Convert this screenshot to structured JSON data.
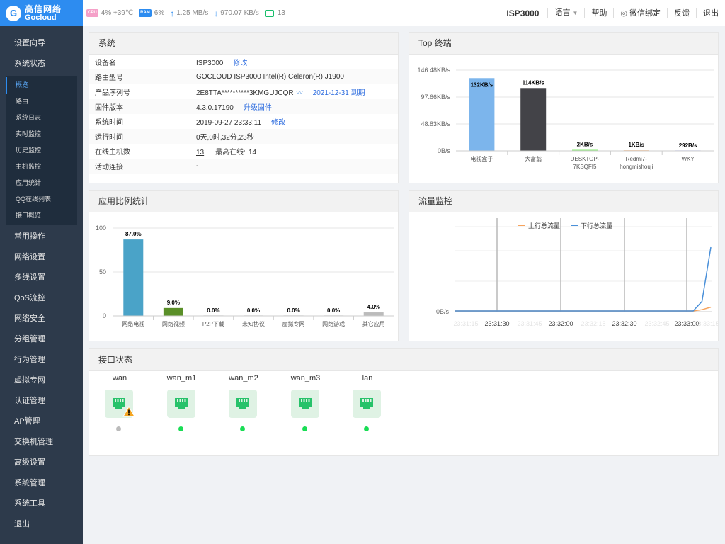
{
  "brand": {
    "name_cn": "高信网络",
    "name_en": "Gocloud",
    "mark": "G",
    "color": "#2d8cf0"
  },
  "topbar": {
    "cpu_tag": "CPU",
    "cpu": "4% +39℃",
    "ram_tag": "RAM",
    "ram": "6%",
    "upload": "1.25 MB/s",
    "download": "970.07 KB/s",
    "monitor": "13",
    "device": "ISP3000",
    "language": "语言",
    "help": "帮助",
    "wechat": "微信绑定",
    "feedback": "反馈",
    "logout": "退出"
  },
  "sidebar": {
    "items_top": [
      "设置向导",
      "系统状态"
    ],
    "sub_items": [
      "概览",
      "路由",
      "系统日志",
      "实时监控",
      "历史监控",
      "主机监控",
      "应用统计",
      "QQ在线列表",
      "接口概览"
    ],
    "active_sub": "概览",
    "items_bottom": [
      "常用操作",
      "网络设置",
      "多线设置",
      "QoS流控",
      "网络安全",
      "分组管理",
      "行为管理",
      "虚拟专网",
      "认证管理",
      "AP管理",
      "交换机管理",
      "高级设置",
      "系统管理",
      "系统工具",
      "退出"
    ]
  },
  "system": {
    "title": "系统",
    "rows": [
      {
        "key": "设备名",
        "value": "ISP3000",
        "link": "修改"
      },
      {
        "key": "路由型号",
        "value": "GOCLOUD ISP3000 Intel(R) Celeron(R) J1900"
      },
      {
        "key": "产品序列号",
        "value": "2E8TTA**********3KMGUJCQR",
        "link": "2021-12-31 到期"
      },
      {
        "key": "固件版本",
        "value": "4.3.0.17190",
        "link": "升级固件"
      },
      {
        "key": "系统时间",
        "value": "2019-09-27 23:33:11",
        "link": "修改"
      },
      {
        "key": "运行时间",
        "value": "0天,0时,32分,23秒"
      },
      {
        "key": "在线主机数",
        "value": "13",
        "extra_label": "最高在线:",
        "extra_value": "14"
      },
      {
        "key": "活动连接",
        "value": "-"
      }
    ]
  },
  "top_terminal": {
    "title": "Top 终端",
    "chart_data": {
      "type": "bar",
      "categories": [
        "电视盒子",
        "大富翁",
        "DESKTOP-7KSQFI5",
        "Redmi7-hongmishouji",
        "WKY"
      ],
      "category_lines": [
        [
          "电视盒子"
        ],
        [
          "大富翁"
        ],
        [
          "DESKTOP-",
          "7KSQFI5"
        ],
        [
          "Redmi7-",
          "hongmishouji"
        ],
        [
          "WKY"
        ]
      ],
      "values": [
        132,
        114,
        2,
        1,
        0.285
      ],
      "labels": [
        "132KB/s",
        "114KB/s",
        "2KB/s",
        "1KB/s",
        "292B/s"
      ],
      "colors": [
        "#7cb5ec",
        "#434348",
        "#90ed7d",
        "#f7a35c",
        "#8085e9"
      ],
      "yticks": [
        0,
        48.83,
        97.66,
        146.48
      ],
      "ytick_labels": [
        "0B/s",
        "48.83KB/s",
        "97.66KB/s",
        "146.48KB/s"
      ],
      "ylim": [
        0,
        146.48
      ]
    }
  },
  "app_ratio": {
    "title": "应用比例统计",
    "chart_data": {
      "type": "bar",
      "categories": [
        "网络电视",
        "网络视频",
        "P2P下载",
        "未知协议",
        "虚拟专网",
        "网络游戏",
        "其它应用"
      ],
      "values": [
        87.0,
        9.0,
        0.0,
        0.0,
        0.0,
        0.0,
        4.0
      ],
      "labels": [
        "87.0%",
        "9.0%",
        "0.0%",
        "0.0%",
        "0.0%",
        "0.0%",
        "4.0%"
      ],
      "colors": [
        "#4aa3c8",
        "#5a8f28",
        "#999999",
        "#999999",
        "#999999",
        "#999999",
        "#bbbbbb"
      ],
      "yticks": [
        0,
        50,
        100
      ],
      "ylim": [
        0,
        100
      ]
    }
  },
  "traffic": {
    "title": "流量监控",
    "chart_data": {
      "type": "line",
      "series": [
        {
          "name": "上行总流量",
          "color": "#f7a35c",
          "values": [
            0,
            0,
            0,
            0,
            0,
            0,
            0,
            0,
            0,
            0,
            0,
            0,
            0,
            0,
            0,
            0,
            0,
            0,
            0,
            0,
            0,
            0,
            0,
            0,
            0,
            0,
            0,
            0,
            0.02,
            0.06
          ]
        },
        {
          "name": "下行总流量",
          "color": "#4a90d9",
          "values": [
            0,
            0,
            0,
            0,
            0,
            0,
            0,
            0,
            0,
            0,
            0,
            0,
            0,
            0,
            0,
            0,
            0,
            0,
            0,
            0,
            0,
            0,
            0,
            0,
            0,
            0,
            0,
            0,
            0.15,
            1.0
          ]
        }
      ],
      "ytick_labels": [
        "0B/s"
      ],
      "xtick_labels": [
        "23:31:30",
        "23:32:00",
        "23:32:30",
        "23:33:00"
      ],
      "faint_labels": [
        "23:31:15",
        "23:31:45",
        "23:32:15",
        "23:32:45",
        "23:33:15"
      ]
    }
  },
  "interfaces": {
    "title": "接口状态",
    "ports": [
      {
        "name": "wan",
        "status": "warning",
        "dot_color": "#bbbbbb"
      },
      {
        "name": "wan_m1",
        "status": "ok",
        "dot_color": "#19dd55"
      },
      {
        "name": "wan_m2",
        "status": "ok",
        "dot_color": "#19dd55"
      },
      {
        "name": "wan_m3",
        "status": "ok",
        "dot_color": "#19dd55"
      },
      {
        "name": "lan",
        "status": "ok",
        "dot_color": "#19dd55"
      }
    ]
  }
}
